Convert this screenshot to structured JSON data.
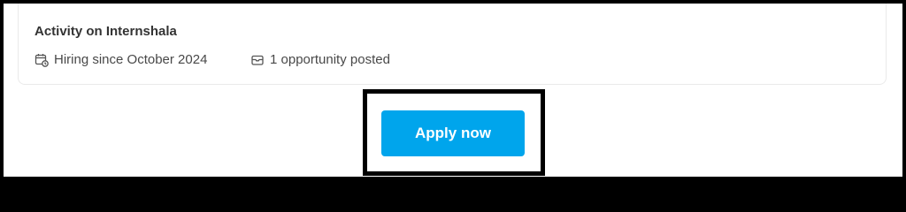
{
  "activity": {
    "title": "Activity on Internshala",
    "hiring_since": "Hiring since October 2024",
    "opportunities": "1 opportunity posted",
    "icons": {
      "hiring": "calendar-clock-icon",
      "opportunities": "briefcase-icon"
    }
  },
  "cta": {
    "apply_label": "Apply now",
    "color": "#00A5EC"
  }
}
